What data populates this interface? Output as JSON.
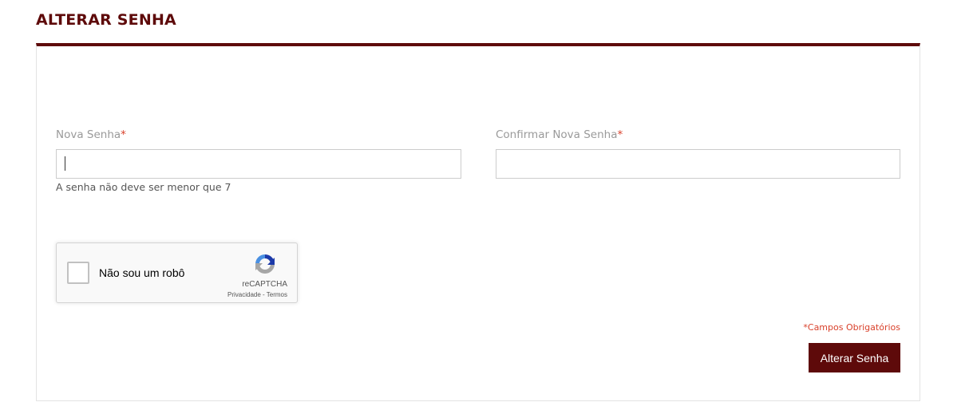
{
  "page": {
    "title": "ALTERAR SENHA"
  },
  "form": {
    "new_password": {
      "label": "Nova Senha",
      "required_mark": "*",
      "value": "",
      "hint": "A senha não deve ser menor que 7"
    },
    "confirm_password": {
      "label": "Confirmar Nova Senha",
      "required_mark": "*",
      "value": ""
    },
    "recaptcha": {
      "checkbox_label": "Não sou um robô",
      "brand": "reCAPTCHA",
      "privacy_link": "Privacidade",
      "separator": " - ",
      "terms_link": "Termos",
      "checked": false
    },
    "required_note": "*Campos Obrigatórios",
    "submit_label": "Alterar Senha"
  },
  "colors": {
    "brand": "#5e0a0a",
    "required": "#d9412b",
    "label": "#9a9a9a",
    "input_border": "#cccccc"
  },
  "icons": {
    "recaptcha_logo": "recaptcha-logo-icon"
  }
}
